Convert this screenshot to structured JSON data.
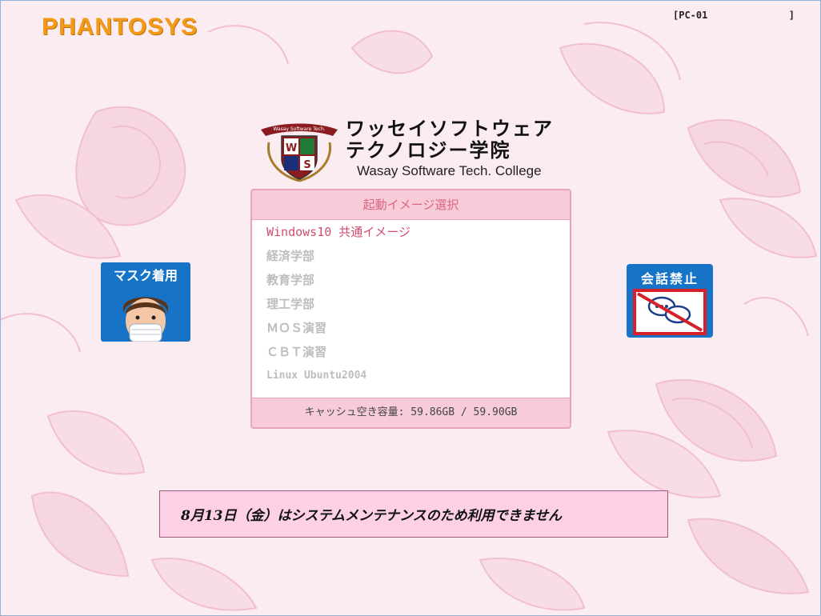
{
  "header": {
    "brand": "PHANTOSYS",
    "pc_open": "[PC-01",
    "pc_close": "]"
  },
  "school": {
    "name_line1": "ワッセイソフトウェア",
    "name_line2": "テクノロジー学院",
    "name_en": "Wasay Software Tech. College",
    "crest_text": "Wasay Software Tech.",
    "crest_letters": [
      "W",
      "S"
    ]
  },
  "boot_panel": {
    "title": "起動イメージ選択",
    "items": [
      {
        "label": "Windows10 共通イメージ"
      },
      {
        "label": "経済学部"
      },
      {
        "label": "教育学部"
      },
      {
        "label": "理工学部"
      },
      {
        "label": "ＭＯＳ演習"
      },
      {
        "label": "ＣＢＴ演習"
      },
      {
        "label": "Linux Ubuntu2004"
      }
    ],
    "cache_label": "キャッシュ空き容量: 59.86GB / 59.90GB"
  },
  "signs": {
    "mask": "マスク着用",
    "no_talk": "会話禁止"
  },
  "notice": "8月13日（金）はシステムメンテナンスのため利用できません",
  "colors": {
    "background": "#fbecf1",
    "accent": "#d24d6e",
    "brand": "#f29a1a",
    "sign_blue": "#1673c6"
  }
}
